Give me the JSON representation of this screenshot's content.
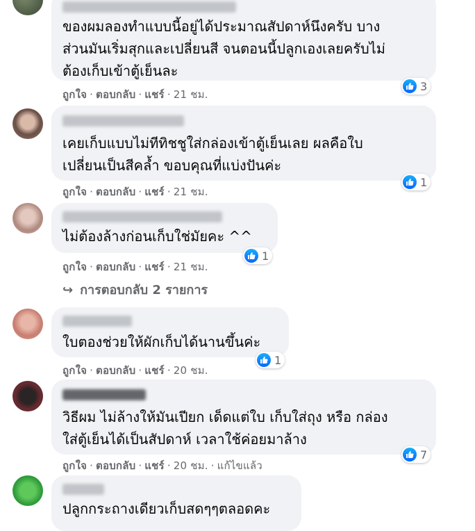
{
  "comments": [
    {
      "text": "ของผมลองทำแบบนี้อยู่ได้ประมาณสัปดาห์นึงครับ บาง\nส่วนมันเริ่มสุกและเปลี่ยนสี จนตอนนี้ปลูกเองเลยครับไม่\nต้องเก็บเข้าตู้เย็นละ",
      "like": "ถูกใจ",
      "reply": "ตอบกลับ",
      "share": "แชร์",
      "time": "21 ชม.",
      "reactions": "3"
    },
    {
      "text": "เคยเก็บแบบไม่ทีทิชชูใส่กล่องเข้าตู้เย็นเลย ผลคือใบ\nเปลี่ยนเป็นสีคล้ำ ขอบคุณที่แบ่งปันค่ะ",
      "like": "ถูกใจ",
      "reply": "ตอบกลับ",
      "share": "แชร์",
      "time": "21 ชม.",
      "reactions": "1"
    },
    {
      "text": "ไม่ต้องล้างก่อนเก็บใช่มัยคะ ^^",
      "like": "ถูกใจ",
      "reply": "ตอบกลับ",
      "share": "แชร์",
      "time": "21 ชม.",
      "reactions": "1"
    },
    {
      "text": "ใบตองช่วยให้ผักเก็บได้นานขึ้นค่ะ",
      "like": "ถูกใจ",
      "reply": "ตอบกลับ",
      "share": "แชร์",
      "time": "20 ชม.",
      "reactions": "1"
    },
    {
      "text": "วิธีผม ไม่ล้างให้มันเปียก เด็ดแต่ใบ เก็บใส่ถุง หรือ กล่อง\nใส่ตู้เย็นได้เป็นสัปดาห์ เวลาใช้ค่อยมาล้าง",
      "like": "ถูกใจ",
      "reply": "ตอบกลับ",
      "share": "แชร์",
      "time": "20 ชม.",
      "edited": "แก้ไขแล้ว",
      "reactions": "7"
    },
    {
      "text": "ปลูกกระถางเดียวเก็บสดๆๆตลอดคะ"
    }
  ],
  "replies_link": "การตอบกลับ 2 รายการ",
  "colors": {
    "bubble": "#f0f2f5",
    "meta": "#65676b",
    "like_blue": "#0866ff"
  },
  "icons": {
    "like": "thumbs-up-icon",
    "reply_arrow": "reply-arrow-icon"
  }
}
